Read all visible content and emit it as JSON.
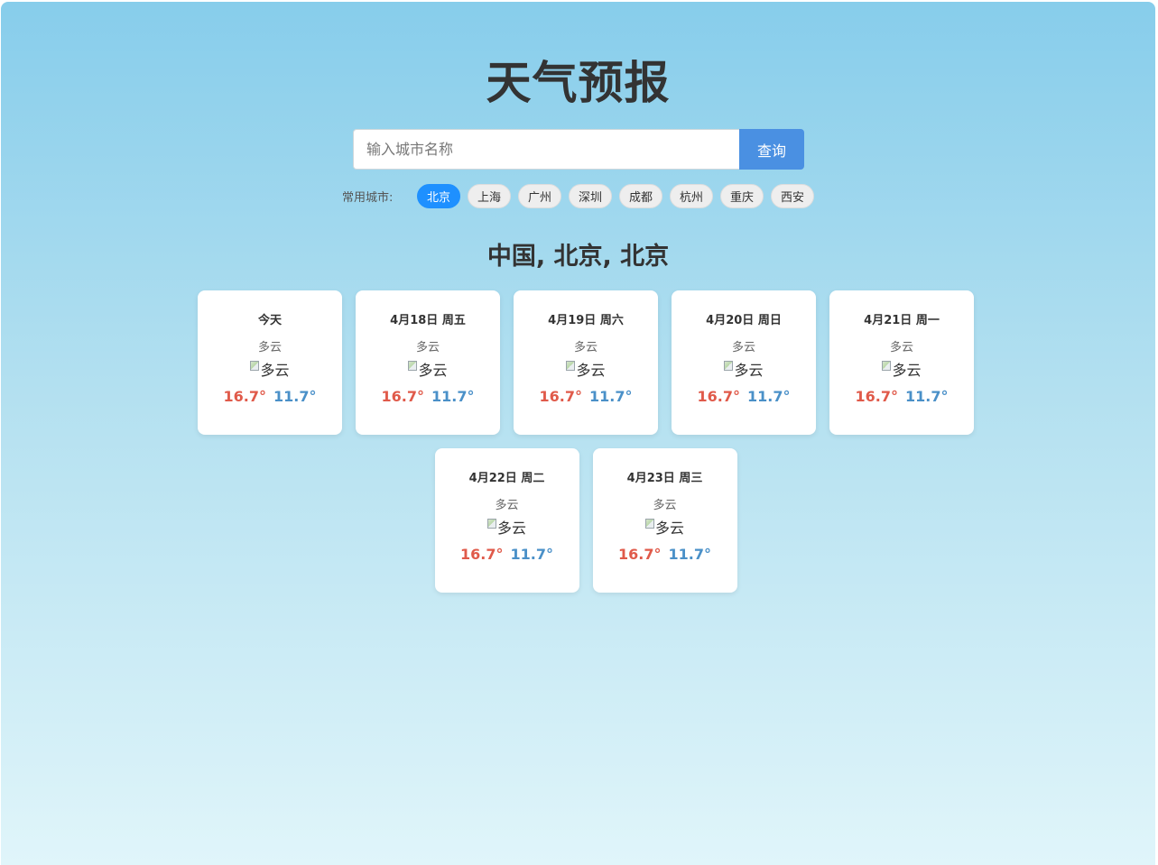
{
  "app": {
    "title": "天气预报"
  },
  "search": {
    "placeholder": "输入城市名称",
    "value": "",
    "button_label": "查询"
  },
  "common_cities": {
    "label": "常用城市:",
    "items": [
      "北京",
      "上海",
      "广州",
      "深圳",
      "成都",
      "杭州",
      "重庆",
      "西安"
    ],
    "selected": "北京"
  },
  "location": "中国, 北京, 北京",
  "forecast": [
    {
      "date": "今天",
      "condition": "多云",
      "icon_alt": "多云",
      "high": "16.7°",
      "low": "11.7°"
    },
    {
      "date": "4月18日 周五",
      "condition": "多云",
      "icon_alt": "多云",
      "high": "16.7°",
      "low": "11.7°"
    },
    {
      "date": "4月19日 周六",
      "condition": "多云",
      "icon_alt": "多云",
      "high": "16.7°",
      "low": "11.7°"
    },
    {
      "date": "4月20日 周日",
      "condition": "多云",
      "icon_alt": "多云",
      "high": "16.7°",
      "low": "11.7°"
    },
    {
      "date": "4月21日 周一",
      "condition": "多云",
      "icon_alt": "多云",
      "high": "16.7°",
      "low": "11.7°"
    },
    {
      "date": "4月22日 周二",
      "condition": "多云",
      "icon_alt": "多云",
      "high": "16.7°",
      "low": "11.7°"
    },
    {
      "date": "4月23日 周三",
      "condition": "多云",
      "icon_alt": "多云",
      "high": "16.7°",
      "low": "11.7°"
    }
  ],
  "colors": {
    "accent": "#4a90e2",
    "chip_active": "#1e90ff",
    "temp_high": "#e05a4a",
    "temp_low": "#4a90c8"
  }
}
